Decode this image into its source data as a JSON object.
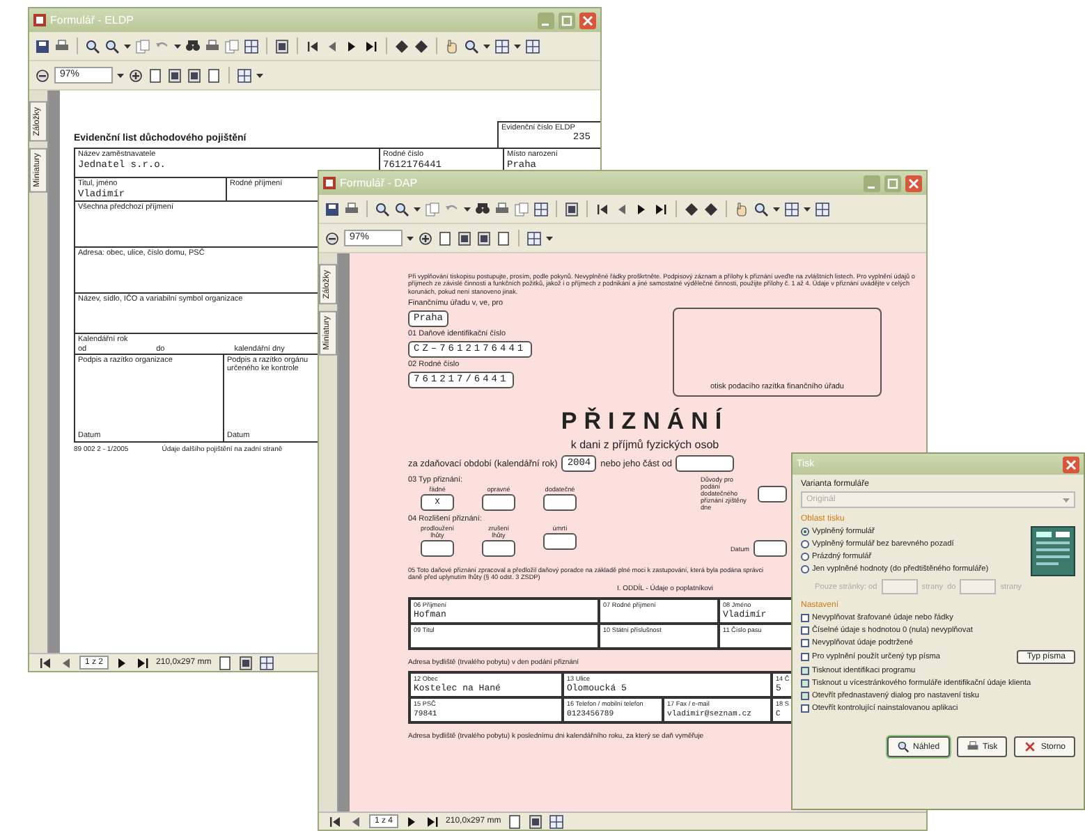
{
  "back_window": {
    "title": "Formulář - ELDP",
    "zoom": "97%",
    "side_tabs": [
      "Záložky",
      "Miniatury"
    ],
    "page": {
      "title": "Evidenční list důchodového pojištění",
      "number_label": "Evidenční číslo ELDP",
      "number": "235",
      "row_1": [
        {
          "label": "Název zaměstnavatele",
          "value": "Jednatel s.r.o."
        },
        {
          "label": "Rodné číslo",
          "value": "7612176441"
        },
        {
          "label": "Místo narození",
          "value": "Praha"
        }
      ],
      "row_2": [
        {
          "label": "Titul, jméno",
          "value": "Vladimír"
        },
        {
          "label": "Rodné příjmení"
        }
      ],
      "previous_names": "Všechna předchozí příjmení",
      "address": "Adresa: obec, ulice, číslo domu, PSČ",
      "organization": "Název, sídlo, IČO a variabilní symbol organizace",
      "year_label": "Kalendářní rok",
      "from": "od",
      "to": "do",
      "days": "kalendářní dny",
      "signatures": [
        {
          "label": "Podpis a razítko organizace",
          "date": "Datum"
        },
        {
          "label": "Podpis a razítko orgánu určeného ke kontrole",
          "date": "Datum"
        }
      ],
      "form_code": "89 002 2 - 1/2005",
      "footnote": "Údaje dalšího pojištění na zadní straně"
    },
    "status": {
      "page": "1 z 2",
      "size": "210,0x297 mm"
    }
  },
  "front_window": {
    "title": "Formulář - DAP",
    "zoom": "97%",
    "side_tabs": [
      "Záložky",
      "Miniatury"
    ],
    "page": {
      "instructions": "Při vyplňování tiskopisu postupujte, prosím, podle pokynů. Nevyplněné řádky proškrtněte. Podpisový záznam a přílohy k přiznání uveďte na zvláštních listech. Pro vyplnění údajů o příjmech ze závislé činnosti a funkčních požitků, jakož i o příjmech z podnikání a jiné samostatné výdělečné činnosti, použijte přílohy č. 1 až 4. Údaje v přiznání uvádějte v celých korunách, pokud není stanoveno jinak.",
      "office_label": "Finančnímu úřadu v, ve, pro",
      "office": "Praha",
      "tax_id_label": "01 Daňové identifikační číslo",
      "tax_id": "CZ–7612176441",
      "birth_number_label": "02 Rodné číslo",
      "birth_number": "761217/6441",
      "stamp_caption": "otisk podacího razítka finančního úřadu",
      "heading": "PŘIZNÁNÍ",
      "subheading": "k dani z příjmů fyzických osob",
      "period_label": "za zdaňovací období (kalendářní rok)",
      "period": "2004",
      "period_part": "nebo jeho část od",
      "type_label": "03 Typ přiznání:",
      "types": [
        {
          "label": "řádné",
          "value": "X"
        },
        {
          "label": "opravné"
        },
        {
          "label": "dodatečné"
        }
      ],
      "reason_label": "Důvody pro podání dodatečného přiznání zjištěny dne",
      "distinction_label": "04 Rozlišení přiznání:",
      "distinctions": [
        {
          "label": "prodloužení lhůty"
        },
        {
          "label": "zrušení lhůty"
        },
        {
          "label": "úmrtí"
        }
      ],
      "date_label": "Datum",
      "advisor": "05 Toto daňové přiznání zpracoval a předložil daňový poradce na základě plné moci k zastupování, která byla podána správci daně před uplynutím lhůty (§ 40 odst. 3 ZSDP)",
      "section": "I. ODDÍL - Údaje o poplatníkovi",
      "person_rows": [
        [
          {
            "label": "06 Příjmení",
            "value": "Hofman"
          },
          {
            "label": "07 Rodné příjmení"
          },
          {
            "label": "08 Jméno",
            "value": "Vladimír"
          }
        ],
        [
          {
            "label": "09 Titul"
          },
          {
            "label": "10 Státní příslušnost"
          },
          {
            "label": "11 Číslo pasu"
          }
        ]
      ],
      "address_heading": "Adresa bydliště (trvalého pobytu) v den podání přiznání",
      "address_rows": [
        [
          {
            "label": "12 Obec",
            "value": "Kostelec na Hané"
          },
          {
            "label": "13 Ulice",
            "value": "Olomoucká 5"
          },
          {
            "label": "14 Č",
            "value": "5"
          }
        ],
        [
          {
            "label": "15 PSČ",
            "value": "79841"
          },
          {
            "label": "16 Telefon / mobilní telefon",
            "value": "0123456789"
          },
          {
            "label": "17 Fax / e-mail",
            "value": "vladimir@seznam.cz"
          },
          {
            "label": "18 S",
            "value": "C"
          }
        ]
      ],
      "last_line": "Adresa bydliště (trvalého pobytu) k poslednímu dni kalendářního roku, za který se daň vyměřuje"
    },
    "status": {
      "page": "1 z 4",
      "size": "210,0x297 mm"
    }
  },
  "print_dialog": {
    "title": "Tisk",
    "variant_label": "Varianta formuláře",
    "variant": {
      "value": "Originál",
      "disabled": true
    },
    "area_label": "Oblast tisku",
    "area_options": [
      {
        "label": "Vyplněný formulář",
        "selected": true
      },
      {
        "label": "Vyplněný formulář bez barevného pozadí",
        "selected": false
      },
      {
        "label": "Prázdný formulář",
        "selected": false
      },
      {
        "label": "Jen vyplněné hodnoty (do předtištěného formuláře)",
        "selected": false
      }
    ],
    "pages": {
      "from_label": "Pouze stránky: od",
      "unit": "strany",
      "to_label": "do",
      "unit_to": "strany",
      "disabled": true
    },
    "settings_label": "Nastavení",
    "settings": [
      {
        "label": "Nevyplňovat šrafované údaje nebo řádky",
        "checked": false
      },
      {
        "label": "Číselné údaje s hodnotou 0 (nula) nevyplňovat",
        "checked": false
      },
      {
        "label": "Nevyplňovat údaje podtržené",
        "checked": false
      },
      {
        "label": "Pro vyplnění použít určený typ písma",
        "checked": false,
        "button": "Typ písma"
      },
      {
        "label": "Tisknout identifikaci programu",
        "checked": true
      },
      {
        "label": "Tisknout u vícestránkového formuláře identifikační údaje klienta",
        "checked": true
      },
      {
        "label": "Otevřít přednastavený dialog pro nastavení tisku",
        "checked": true
      },
      {
        "label": "Otevřít kontrolující nainstalovanou aplikaci",
        "checked": false
      }
    ],
    "buttons": [
      {
        "label": "Náhled",
        "kind": "preview",
        "default": true
      },
      {
        "label": "Tisk",
        "kind": "print",
        "default": false
      },
      {
        "label": "Storno",
        "kind": "cancel",
        "default": false
      }
    ]
  }
}
